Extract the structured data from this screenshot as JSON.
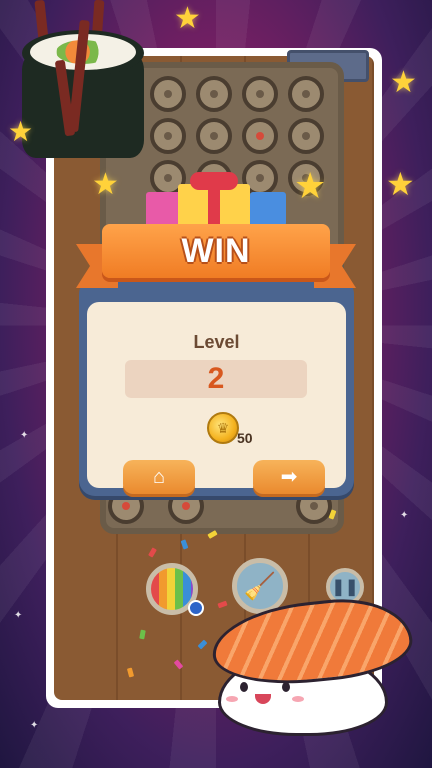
{
  "win_dialog": {
    "banner_text": "WIN",
    "level_label": "Level",
    "level_value": "2",
    "coin_reward": "50",
    "home_button_icon": "home-icon",
    "next_button_icon": "right-arrow-icon"
  },
  "controls": {
    "rainbow_icon": "rainbow-disc-icon",
    "tool_icon": "broom-icon",
    "pause_icon": "pause-icon"
  },
  "colors": {
    "banner": "#f07c24",
    "card_frame": "#4b6590",
    "card_bg": "#f7ebd8",
    "level_value": "#d8581f",
    "button": "#ea8a2e"
  }
}
